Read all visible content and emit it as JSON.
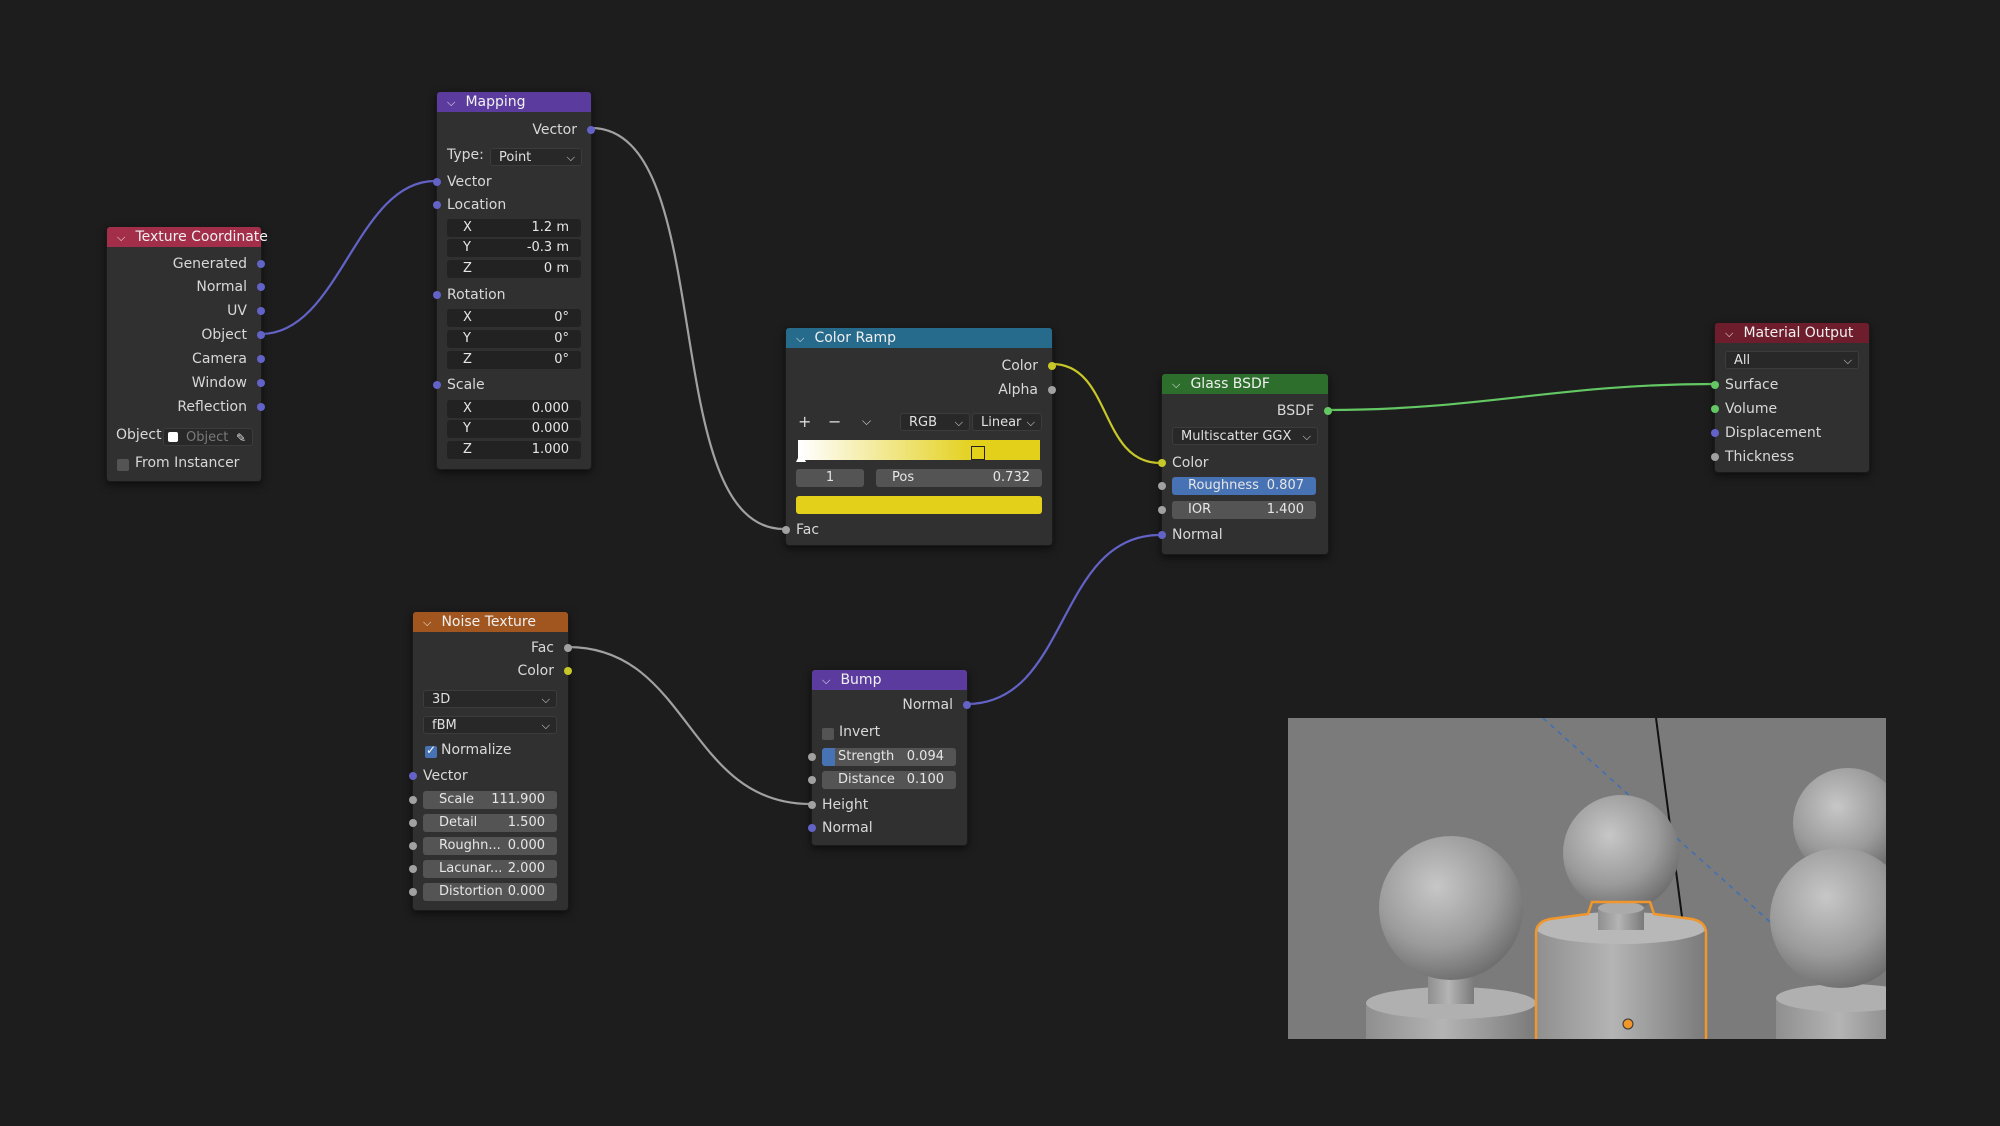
{
  "colors": {
    "background": "#1d1d1d",
    "texture_coordinate_header": "#a22e4a",
    "mapping_header": "#5b3c9e",
    "color_ramp_header": "#266a8c",
    "glass_bsdf_header": "#2d6e2d",
    "material_output_header": "#6e1d2c",
    "noise_texture_header": "#a0561e",
    "bump_header": "#5b3c9e",
    "vector_socket": "#6363c7",
    "color_socket": "#c7c729",
    "float_socket": "#a1a1a1",
    "shader_socket": "#63c763",
    "selection_outline": "#f0962a"
  },
  "nodes": {
    "texture_coordinate": {
      "title": "Texture Coordinate",
      "outputs": [
        "Generated",
        "Normal",
        "UV",
        "Object",
        "Camera",
        "Window",
        "Reflection"
      ],
      "object_label": "Object:",
      "object_placeholder": "Object",
      "from_instancer": "From Instancer"
    },
    "mapping": {
      "title": "Mapping",
      "output": "Vector",
      "type_label": "Type:",
      "type_value": "Point",
      "vector_input": "Vector",
      "location_label": "Location",
      "location": [
        {
          "k": "X",
          "v": "1.2 m"
        },
        {
          "k": "Y",
          "v": "-0.3 m"
        },
        {
          "k": "Z",
          "v": "0 m"
        }
      ],
      "rotation_label": "Rotation",
      "rotation": [
        {
          "k": "X",
          "v": "0°"
        },
        {
          "k": "Y",
          "v": "0°"
        },
        {
          "k": "Z",
          "v": "0°"
        }
      ],
      "scale_label": "Scale",
      "scale": [
        {
          "k": "X",
          "v": "0.000"
        },
        {
          "k": "Y",
          "v": "0.000"
        },
        {
          "k": "Z",
          "v": "1.000"
        }
      ]
    },
    "color_ramp": {
      "title": "Color Ramp",
      "outputs": [
        "Color",
        "Alpha"
      ],
      "plus": "+",
      "minus": "−",
      "mode": "RGB",
      "interpolation": "Linear",
      "index": "1",
      "pos_label": "Pos",
      "pos_value": "0.732",
      "stop_color": "#e3d01b",
      "input": "Fac"
    },
    "glass_bsdf": {
      "title": "Glass BSDF",
      "output": "BSDF",
      "distribution": "Multiscatter GGX",
      "color_input": "Color",
      "roughness_label": "Roughness",
      "roughness_value": "0.807",
      "roughness_fraction": 0.807,
      "ior_label": "IOR",
      "ior_value": "1.400",
      "normal_input": "Normal"
    },
    "material_output": {
      "title": "Material Output",
      "target": "All",
      "inputs": [
        "Surface",
        "Volume",
        "Displacement",
        "Thickness"
      ]
    },
    "noise_texture": {
      "title": "Noise Texture",
      "outputs": [
        "Fac",
        "Color"
      ],
      "dimensions": "3D",
      "noise_type": "fBM",
      "normalize": "Normalize",
      "vector_input": "Vector",
      "fields": [
        {
          "k": "Scale",
          "v": "111.900"
        },
        {
          "k": "Detail",
          "v": "1.500"
        },
        {
          "k": "Roughn...",
          "v": "0.000"
        },
        {
          "k": "Lacunar...",
          "v": "2.000"
        },
        {
          "k": "Distortion",
          "v": "0.000"
        }
      ]
    },
    "bump": {
      "title": "Bump",
      "output": "Normal",
      "invert": "Invert",
      "strength_label": "Strength",
      "strength_value": "0.094",
      "strength_fraction": 0.094,
      "distance_label": "Distance",
      "distance_value": "0.100",
      "height_input": "Height",
      "normal_input": "Normal"
    }
  },
  "icons": {
    "collapse": "chevron-down-icon",
    "dropdown": "chevron-down-icon",
    "eyedropper": "eyedropper-icon"
  }
}
